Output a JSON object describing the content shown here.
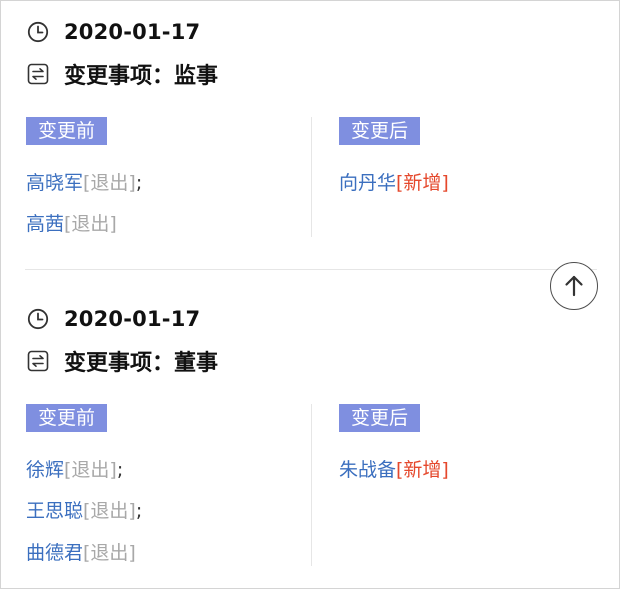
{
  "records": [
    {
      "date": "2020-01-17",
      "change_item": "变更事项：监事",
      "before_label": "变更前",
      "after_label": "变更后",
      "before": [
        {
          "name": "高晓军",
          "status": "[退出]",
          "sep": ";"
        },
        {
          "name": "高茜",
          "status": "[退出]",
          "sep": ""
        }
      ],
      "after": [
        {
          "name": "向丹华",
          "status": "[新增]",
          "sep": ""
        }
      ]
    },
    {
      "date": "2020-01-17",
      "change_item": "变更事项：董事",
      "before_label": "变更前",
      "after_label": "变更后",
      "before": [
        {
          "name": "徐辉",
          "status": "[退出]",
          "sep": ";"
        },
        {
          "name": "王思聪",
          "status": "[退出]",
          "sep": ";"
        },
        {
          "name": "曲德君",
          "status": "[退出]",
          "sep": ""
        }
      ],
      "after": [
        {
          "name": "朱战备",
          "status": "[新增]",
          "sep": ""
        }
      ]
    }
  ],
  "icons": {
    "date": "clock-icon",
    "change_item": "exchange-icon",
    "back_to_top": "arrow-up-icon"
  },
  "colors": {
    "tag_bg": "#7f8fe0",
    "name": "#3b6fbf",
    "status_out": "#a8a8a8",
    "status_new": "#e5482c"
  }
}
